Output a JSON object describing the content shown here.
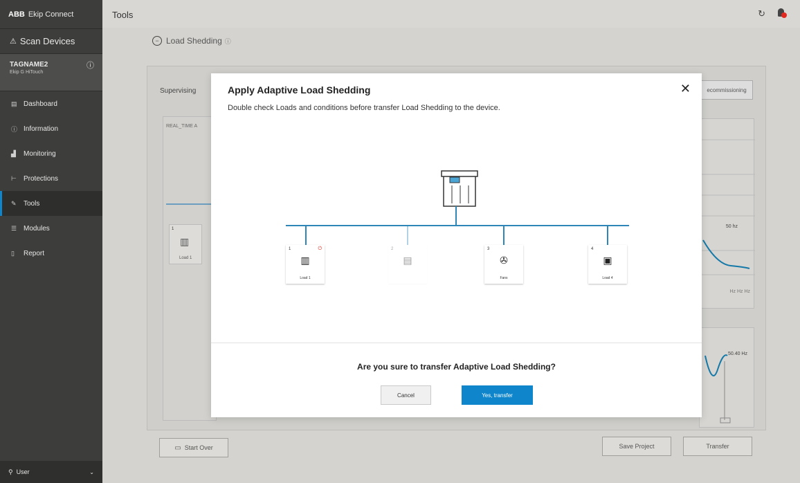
{
  "app": {
    "brand": "ABB",
    "name": "Ekip Connect"
  },
  "sidebar": {
    "scan_label": "Scan Devices",
    "device": {
      "tag": "TAGNAME2",
      "sub": "Ekip G HiTouch"
    },
    "items": [
      {
        "label": "Dashboard",
        "icon": "dashboard-icon"
      },
      {
        "label": "Information",
        "icon": "info-icon"
      },
      {
        "label": "Monitoring",
        "icon": "monitoring-icon"
      },
      {
        "label": "Protections",
        "icon": "protections-icon"
      },
      {
        "label": "Tools",
        "icon": "wrench-icon",
        "active": true
      },
      {
        "label": "Modules",
        "icon": "modules-icon"
      },
      {
        "label": "Report",
        "icon": "report-icon"
      }
    ],
    "user_label": "User"
  },
  "topbar": {
    "title": "Tools"
  },
  "page": {
    "heading": "Load Shedding"
  },
  "panel": {
    "supervising_label": "Supervising",
    "realtime_label": "REAL_TIME A",
    "decommission_label": "ecommissioning",
    "chart_label": "50 hz",
    "chart_ticks": "Hz   Hz   Hz",
    "hz_label": "50.40 Hz"
  },
  "footer": {
    "start_over": "Start Over",
    "save_project": "Save Project",
    "transfer": "Transfer"
  },
  "modal": {
    "title": "Apply Adaptive Load Shedding",
    "description": "Double check Loads and conditions before transfer Load Shedding to the device.",
    "question": "Are you sure to transfer Adaptive Load Shedding?",
    "cancel": "Cancel",
    "confirm": "Yes, transfer",
    "loads": [
      {
        "num": "1",
        "label": "Load 1",
        "icon": "heater-icon",
        "power": true,
        "enabled": true
      },
      {
        "num": "2",
        "label": "",
        "icon": "generic-load-icon",
        "power": false,
        "enabled": false
      },
      {
        "num": "3",
        "label": "Fans",
        "icon": "fan-icon",
        "power": false,
        "enabled": true
      },
      {
        "num": "4",
        "label": "Load 4",
        "icon": "washing-machine-icon",
        "power": false,
        "enabled": true
      }
    ]
  },
  "colors": {
    "accent": "#0f86cc",
    "bus_line": "#2e86b8",
    "alert": "#e3281f"
  }
}
